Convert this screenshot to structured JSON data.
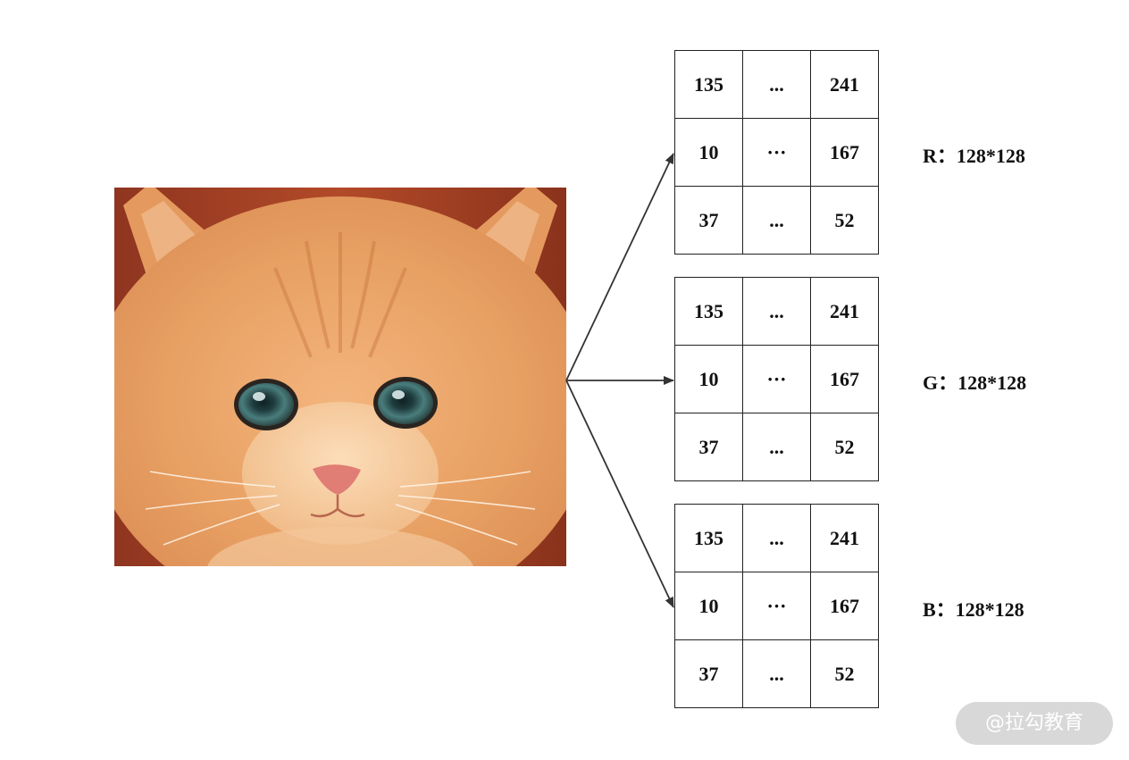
{
  "image": {
    "subject": "orange-kitten-face",
    "colors": {
      "fur": "#e9a36a",
      "fur_dark": "#c87845",
      "fur_light": "#f6cfa0",
      "background": "#9c3d24",
      "eye": "#3f6f72",
      "nose": "#e2837a"
    }
  },
  "arrow_color": "#333333",
  "channels": [
    {
      "label": "R：128*128",
      "rows": [
        [
          "135",
          "...",
          "241"
        ],
        [
          "10",
          "···",
          "167"
        ],
        [
          "37",
          "...",
          "52"
        ]
      ]
    },
    {
      "label": "G：128*128",
      "rows": [
        [
          "135",
          "...",
          "241"
        ],
        [
          "10",
          "···",
          "167"
        ],
        [
          "37",
          "...",
          "52"
        ]
      ]
    },
    {
      "label": "B：128*128",
      "rows": [
        [
          "135",
          "...",
          "241"
        ],
        [
          "10",
          "···",
          "167"
        ],
        [
          "37",
          "...",
          "52"
        ]
      ]
    }
  ],
  "watermark": "@拉勾教育"
}
